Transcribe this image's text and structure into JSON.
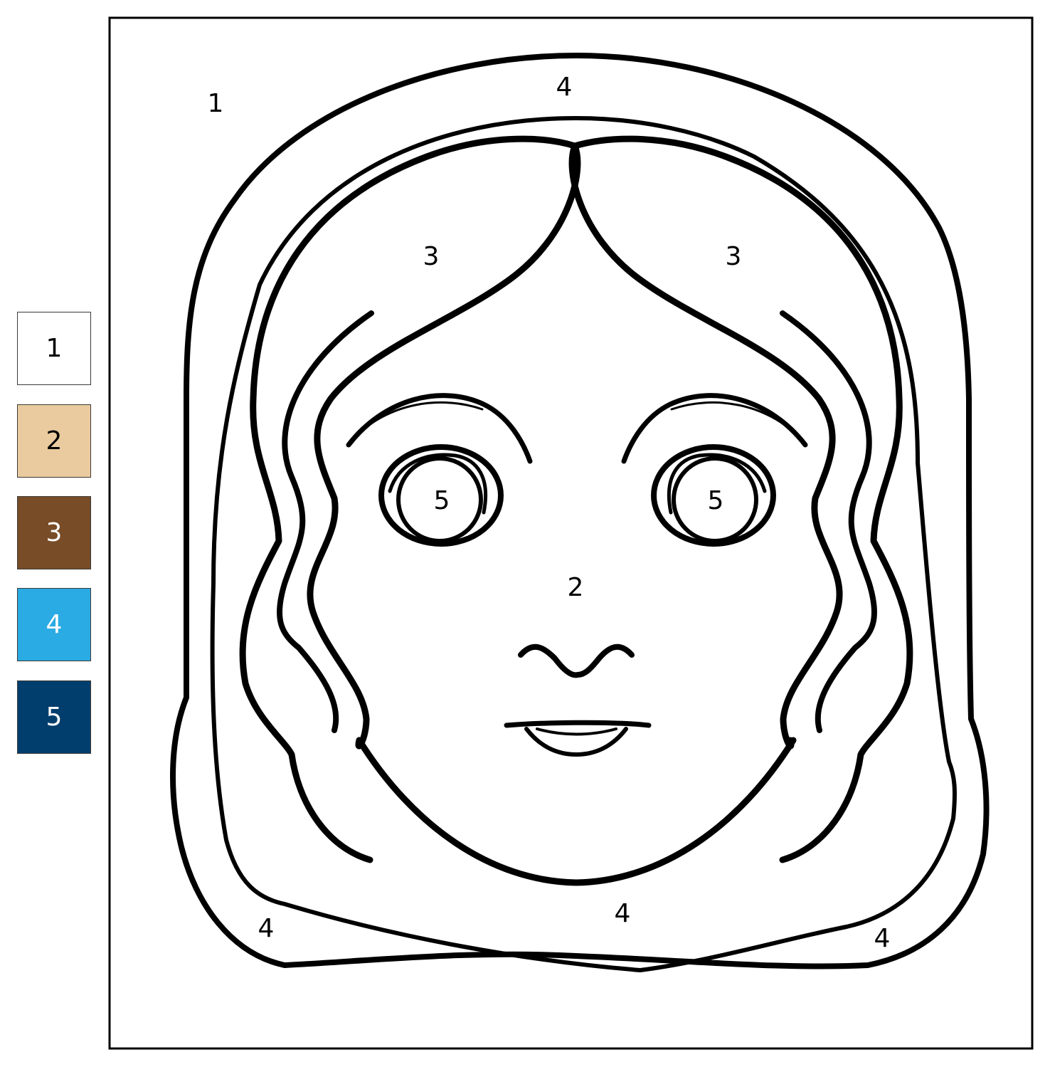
{
  "palette": [
    {
      "number": "1",
      "color": "#ffffff",
      "text_color": "#000000"
    },
    {
      "number": "2",
      "color": "#eacb9f",
      "text_color": "#000000"
    },
    {
      "number": "3",
      "color": "#774c27",
      "text_color": "#ffffff"
    },
    {
      "number": "4",
      "color": "#2aabe3",
      "text_color": "#ffffff"
    },
    {
      "number": "5",
      "color": "#023e6d",
      "text_color": "#ffffff"
    }
  ],
  "labels": {
    "background": "1",
    "scarf_top": "4",
    "hair_left": "3",
    "hair_right": "3",
    "eye_left": "5",
    "eye_right": "5",
    "face": "2",
    "scarf_bottom_left": "4",
    "scarf_bottom_center": "4",
    "scarf_bottom_right": "4"
  }
}
